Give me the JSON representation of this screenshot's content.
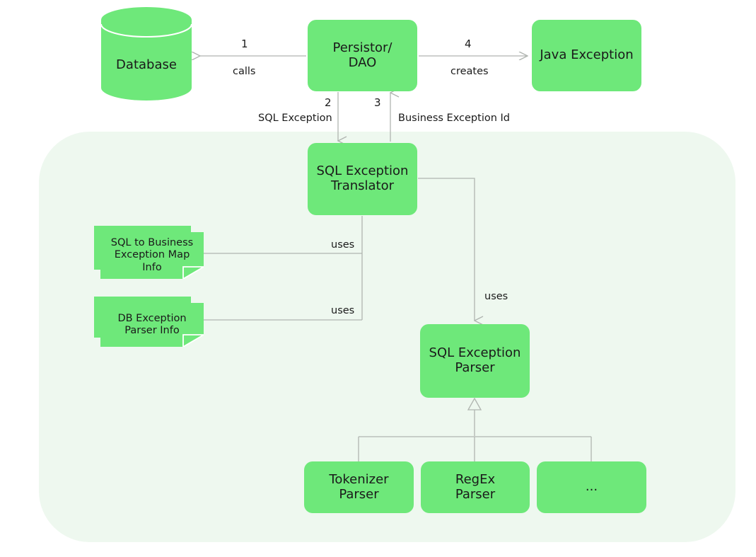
{
  "diagram": {
    "title_present": false,
    "colors": {
      "node_fill": "#6EE87A",
      "container_fill": "#EEF8EF",
      "line": "#b0b5b0",
      "text": "#1a1a1a",
      "page_background": "#FFFFFF"
    },
    "container": {
      "name": "exception-translation-subsystem"
    },
    "nodes": [
      {
        "id": "database",
        "label": "Database",
        "shape": "cylinder"
      },
      {
        "id": "persistor",
        "label": "Persistor/\nDAO",
        "shape": "rounded-rect",
        "line1": "Persistor/",
        "line2": "DAO"
      },
      {
        "id": "javaex",
        "label": "Java Exception",
        "shape": "rounded-rect",
        "line1": "Java Exception",
        "line2": ""
      },
      {
        "id": "translator",
        "label": "SQL Exception Translator",
        "shape": "rounded-rect",
        "line1": "SQL Exception",
        "line2": "Translator"
      },
      {
        "id": "parser",
        "label": "SQL Exception Parser",
        "shape": "rounded-rect",
        "line1": "SQL Exception",
        "line2": "Parser"
      },
      {
        "id": "tokenizer",
        "label": "Tokenizer Parser",
        "shape": "rounded-rect",
        "line1": "Tokenizer",
        "line2": "Parser"
      },
      {
        "id": "regex",
        "label": "RegEx Parser",
        "shape": "rounded-rect",
        "line1": "RegEx",
        "line2": "Parser"
      },
      {
        "id": "ellipsis",
        "label": "...",
        "shape": "rounded-rect",
        "line1": "...",
        "line2": ""
      }
    ],
    "notes": [
      {
        "id": "note-sql-to-business",
        "line1": "SQL to Business",
        "line2": "Exception Map",
        "line3": "Info"
      },
      {
        "id": "note-db-exception",
        "line1": "DB Exception",
        "line2": "Parser Info",
        "line3": ""
      }
    ],
    "edges": [
      {
        "id": "edge-1",
        "number": "1",
        "label": "calls",
        "from": "persistor",
        "to": "database"
      },
      {
        "id": "edge-2",
        "number": "2",
        "label": "SQL Exception",
        "from": "persistor",
        "to": "translator"
      },
      {
        "id": "edge-3",
        "number": "3",
        "label": "Business Exception Id",
        "from": "translator",
        "to": "persistor"
      },
      {
        "id": "edge-4",
        "number": "4",
        "label": "creates",
        "from": "persistor",
        "to": "javaex"
      },
      {
        "id": "edge-5",
        "number": "",
        "label": "uses",
        "from": "translator",
        "to": "note-sql-to-business"
      },
      {
        "id": "edge-6",
        "number": "",
        "label": "uses",
        "from": "translator",
        "to": "note-db-exception"
      },
      {
        "id": "edge-7",
        "number": "",
        "label": "uses",
        "from": "translator",
        "to": "parser"
      },
      {
        "id": "edge-8",
        "number": "",
        "label": "",
        "from": "tokenizer",
        "to": "parser"
      },
      {
        "id": "edge-9",
        "number": "",
        "label": "",
        "from": "regex",
        "to": "parser"
      },
      {
        "id": "edge-10",
        "number": "",
        "label": "",
        "from": "ellipsis",
        "to": "parser"
      }
    ]
  }
}
